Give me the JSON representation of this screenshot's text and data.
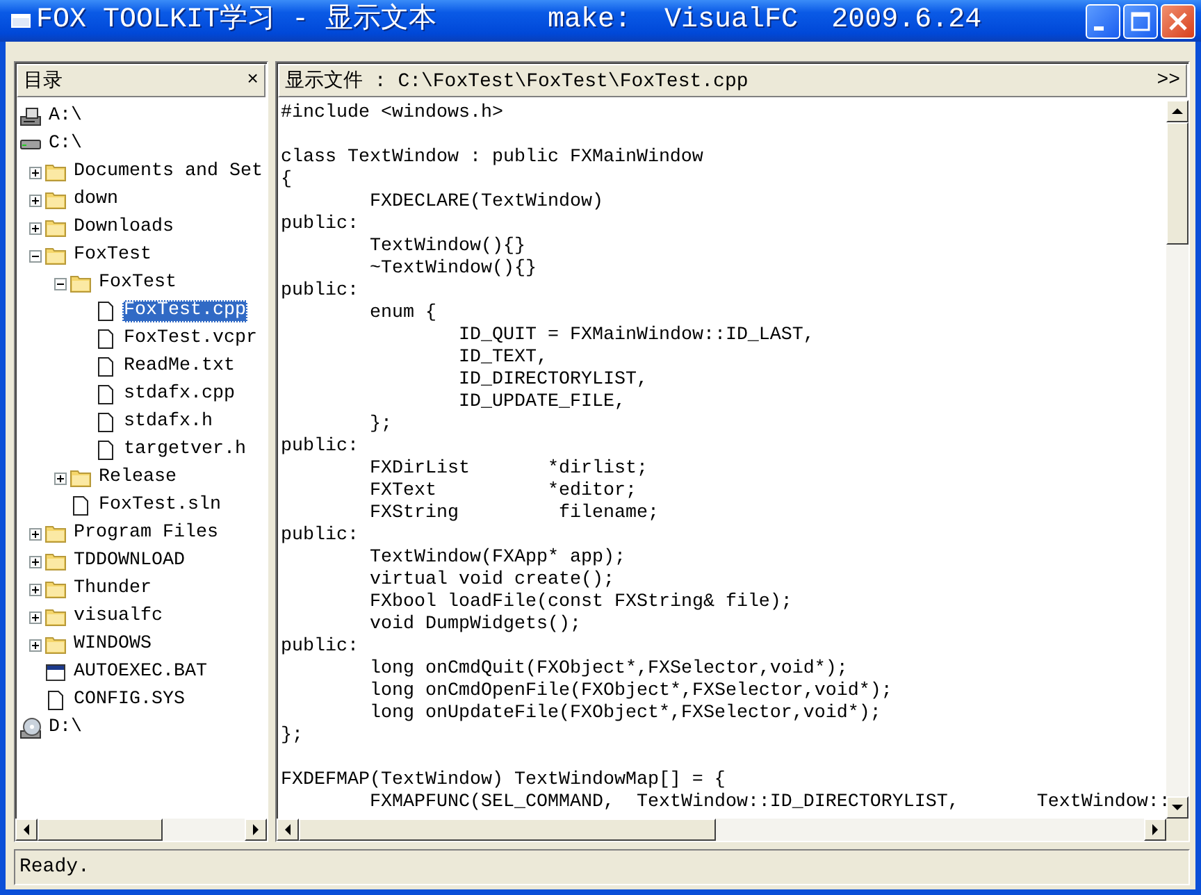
{
  "window": {
    "title": "FOX TOOLKIT学习 - 显示文本",
    "subtitle": "make:  VisualFC  2009.6.24"
  },
  "left_panel": {
    "title": "目录",
    "close": "×"
  },
  "tree": [
    {
      "label": "A:\\",
      "kind": "floppy",
      "selected": false
    },
    {
      "label": "C:\\",
      "kind": "disk",
      "selected": false,
      "children": [
        {
          "label": "Documents and Set",
          "kind": "folder",
          "expanded": false,
          "selected": false
        },
        {
          "label": "down",
          "kind": "folder",
          "expanded": false,
          "selected": false
        },
        {
          "label": "Downloads",
          "kind": "folder",
          "expanded": false,
          "selected": false
        },
        {
          "label": "FoxTest",
          "kind": "folder",
          "expanded": true,
          "selected": false,
          "children": [
            {
              "label": "FoxTest",
              "kind": "folder",
              "expanded": true,
              "selected": false,
              "children": [
                {
                  "label": "FoxTest.cpp",
                  "kind": "file",
                  "selected": true
                },
                {
                  "label": "FoxTest.vcpr",
                  "kind": "file",
                  "selected": false
                },
                {
                  "label": "ReadMe.txt",
                  "kind": "file",
                  "selected": false
                },
                {
                  "label": "stdafx.cpp",
                  "kind": "file",
                  "selected": false
                },
                {
                  "label": "stdafx.h",
                  "kind": "file",
                  "selected": false
                },
                {
                  "label": "targetver.h",
                  "kind": "file",
                  "selected": false
                }
              ]
            },
            {
              "label": "Release",
              "kind": "folder",
              "expanded": false,
              "selected": false
            },
            {
              "label": "FoxTest.sln",
              "kind": "file",
              "selected": false
            }
          ]
        },
        {
          "label": "Program Files",
          "kind": "folder",
          "expanded": false,
          "selected": false
        },
        {
          "label": "TDDOWNLOAD",
          "kind": "folder",
          "expanded": false,
          "selected": false
        },
        {
          "label": "Thunder",
          "kind": "folder",
          "expanded": false,
          "selected": false
        },
        {
          "label": "visualfc",
          "kind": "folder",
          "expanded": false,
          "selected": false
        },
        {
          "label": "WINDOWS",
          "kind": "folder",
          "expanded": false,
          "selected": false
        },
        {
          "label": "AUTOEXEC.BAT",
          "kind": "batch",
          "selected": false
        },
        {
          "label": "CONFIG.SYS",
          "kind": "file",
          "selected": false
        }
      ]
    },
    {
      "label": "D:\\",
      "kind": "cdrom",
      "selected": false
    }
  ],
  "right_panel": {
    "title": "显示文件 : C:\\FoxTest\\FoxTest\\FoxTest.cpp",
    "more": ">>"
  },
  "code": "#include <windows.h>\n\nclass TextWindow : public FXMainWindow\n{\n\tFXDECLARE(TextWindow)\npublic:\n\tTextWindow(){}\n\t~TextWindow(){}\npublic:\n\tenum {\n\t\tID_QUIT = FXMainWindow::ID_LAST,\n\t\tID_TEXT,\n\t\tID_DIRECTORYLIST,\n\t\tID_UPDATE_FILE,\n\t};\npublic:\n\tFXDirList       *dirlist;\n\tFXText          *editor;\n\tFXString         filename;\npublic:\n\tTextWindow(FXApp* app);\n\tvirtual void create();\n\tFXbool loadFile(const FXString& file);\n\tvoid DumpWidgets();\npublic:\n\tlong onCmdQuit(FXObject*,FXSelector,void*);\n\tlong onCmdOpenFile(FXObject*,FXSelector,void*);\n\tlong onUpdateFile(FXObject*,FXSelector,void*);\n};\n\nFXDEFMAP(TextWindow) TextWindowMap[] = {\n\tFXMAPFUNC(SEL_COMMAND,  TextWindow::ID_DIRECTORYLIST,       TextWindow::",
  "status_bar": "Ready."
}
